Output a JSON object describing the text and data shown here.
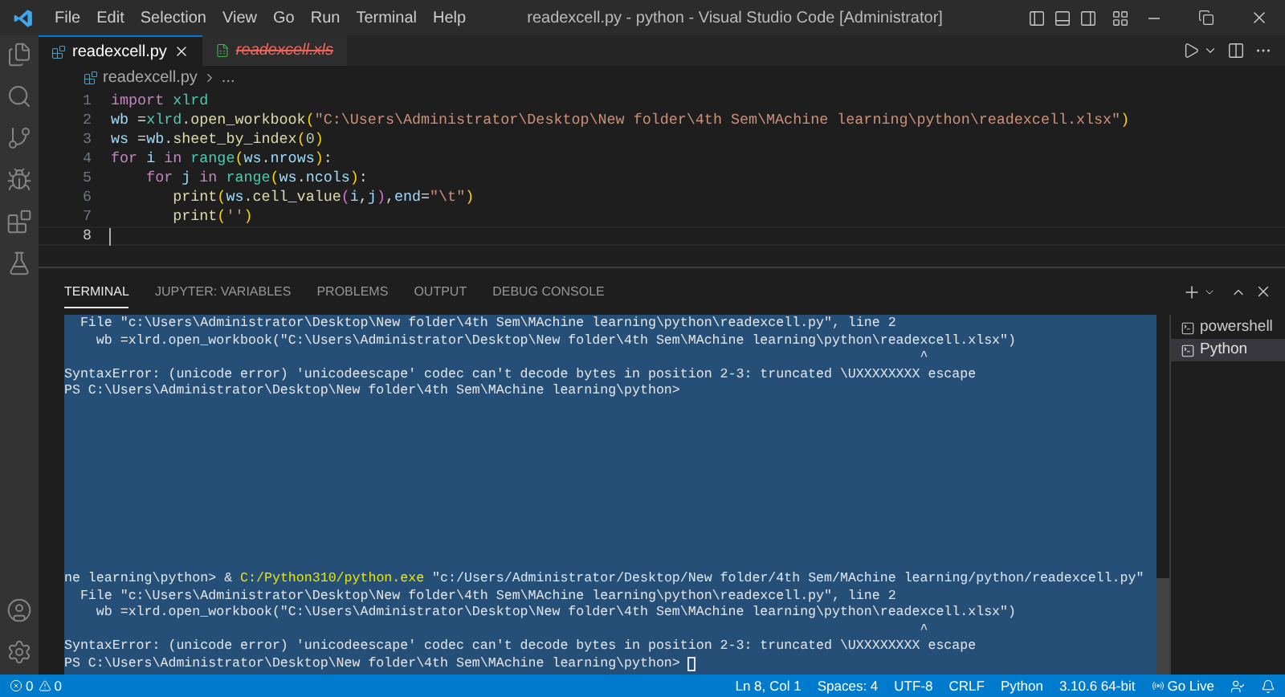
{
  "title_bar": {
    "menu": [
      "File",
      "Edit",
      "Selection",
      "View",
      "Go",
      "Run",
      "Terminal",
      "Help"
    ],
    "title": "readexcell.py - python - Visual Studio Code [Administrator]"
  },
  "editor": {
    "tabs": [
      {
        "label": "readexcell.py",
        "selected": true,
        "deleted": false,
        "kind": "python"
      },
      {
        "label": "readexcell.xls",
        "selected": false,
        "deleted": true,
        "kind": "excel"
      }
    ],
    "breadcrumb": {
      "file": "readexcell.py",
      "more": "..."
    },
    "lines": [
      {
        "number": "1",
        "current": false,
        "tokens": [
          {
            "text": "import ",
            "kind": "keyword"
          },
          {
            "text": "xlrd",
            "kind": "module"
          }
        ]
      },
      {
        "number": "2",
        "current": false,
        "tokens": [
          {
            "text": "wb",
            "kind": "variable"
          },
          {
            "text": " =",
            "kind": "plain"
          },
          {
            "text": "xlrd",
            "kind": "module"
          },
          {
            "text": ".",
            "kind": "plain"
          },
          {
            "text": "open_workbook",
            "kind": "function"
          },
          {
            "text": "(",
            "kind": "bracket1"
          },
          {
            "text": "\"C:\\Users\\Administrator\\Desktop\\New folder\\4th Sem\\MAchine learning\\python\\readexcell.xlsx\"",
            "kind": "string"
          },
          {
            "text": ")",
            "kind": "bracket1"
          }
        ]
      },
      {
        "number": "3",
        "current": false,
        "tokens": [
          {
            "text": "ws",
            "kind": "variable"
          },
          {
            "text": " =",
            "kind": "plain"
          },
          {
            "text": "wb",
            "kind": "variable"
          },
          {
            "text": ".",
            "kind": "plain"
          },
          {
            "text": "sheet_by_index",
            "kind": "function"
          },
          {
            "text": "(",
            "kind": "bracket1"
          },
          {
            "text": "0",
            "kind": "number"
          },
          {
            "text": ")",
            "kind": "bracket1"
          }
        ]
      },
      {
        "number": "4",
        "current": false,
        "tokens": [
          {
            "text": "for ",
            "kind": "keyword"
          },
          {
            "text": "i ",
            "kind": "variable"
          },
          {
            "text": "in ",
            "kind": "keyword"
          },
          {
            "text": "range",
            "kind": "module"
          },
          {
            "text": "(",
            "kind": "bracket1"
          },
          {
            "text": "ws",
            "kind": "variable"
          },
          {
            "text": ".",
            "kind": "plain"
          },
          {
            "text": "nrows",
            "kind": "variable"
          },
          {
            "text": ")",
            "kind": "bracket1"
          },
          {
            "text": ":",
            "kind": "plain"
          }
        ]
      },
      {
        "number": "5",
        "current": false,
        "tokens": [
          {
            "text": "    for ",
            "kind": "keyword"
          },
          {
            "text": "j ",
            "kind": "variable"
          },
          {
            "text": "in ",
            "kind": "keyword"
          },
          {
            "text": "range",
            "kind": "module"
          },
          {
            "text": "(",
            "kind": "bracket1"
          },
          {
            "text": "ws",
            "kind": "variable"
          },
          {
            "text": ".",
            "kind": "plain"
          },
          {
            "text": "ncols",
            "kind": "variable"
          },
          {
            "text": ")",
            "kind": "bracket1"
          },
          {
            "text": ":",
            "kind": "plain"
          }
        ]
      },
      {
        "number": "6",
        "current": false,
        "tokens": [
          {
            "text": "       print",
            "kind": "function"
          },
          {
            "text": "(",
            "kind": "bracket1"
          },
          {
            "text": "ws",
            "kind": "variable"
          },
          {
            "text": ".",
            "kind": "plain"
          },
          {
            "text": "cell_value",
            "kind": "function"
          },
          {
            "text": "(",
            "kind": "bracket2"
          },
          {
            "text": "i",
            "kind": "variable"
          },
          {
            "text": ",",
            "kind": "plain"
          },
          {
            "text": "j",
            "kind": "variable"
          },
          {
            "text": ")",
            "kind": "bracket2"
          },
          {
            "text": ",",
            "kind": "plain"
          },
          {
            "text": "end",
            "kind": "variable"
          },
          {
            "text": "=",
            "kind": "plain"
          },
          {
            "text": "\"\\t\"",
            "kind": "string"
          },
          {
            "text": ")",
            "kind": "bracket1"
          }
        ]
      },
      {
        "number": "7",
        "current": false,
        "tokens": [
          {
            "text": "       print",
            "kind": "function"
          },
          {
            "text": "(",
            "kind": "bracket1"
          },
          {
            "text": "''",
            "kind": "string"
          },
          {
            "text": ")",
            "kind": "bracket1"
          }
        ]
      },
      {
        "number": "8",
        "current": true
      }
    ]
  },
  "panel": {
    "tabs": [
      {
        "label": "TERMINAL",
        "selected": true
      },
      {
        "label": "JUPYTER: VARIABLES",
        "selected": false
      },
      {
        "label": "PROBLEMS",
        "selected": false
      },
      {
        "label": "OUTPUT",
        "selected": false
      },
      {
        "label": "DEBUG CONSOLE",
        "selected": false
      }
    ],
    "terminal": {
      "selected": true,
      "blocks": [
        [
          [
            {
              "text": "  File \"c:\\Users\\Administrator\\Desktop\\New folder\\4th Sem\\MAchine learning\\python\\readexcell.py\", line 2",
              "kind": "plain"
            }
          ],
          [
            {
              "text": "    wb =xlrd.open_workbook(\"C:\\Users\\Administrator\\Desktop\\New folder\\4th Sem\\MAchine learning\\python\\readexcell.xlsx\")",
              "kind": "plain"
            }
          ],
          [
            {
              "text": "                                                                                                           ^",
              "kind": "plain"
            }
          ],
          [
            {
              "text": "SyntaxError: (unicode error) 'unicodeescape' codec can't decode bytes in position 2-3: truncated \\UXXXXXXXX escape",
              "kind": "plain"
            }
          ],
          [
            {
              "text": "PS C:\\Users\\Administrator\\Desktop\\New folder\\4th Sem\\MAchine learning\\python>",
              "kind": "plain"
            }
          ]
        ],
        [
          [
            {
              "text": "ne learning\\python> & ",
              "kind": "plain"
            },
            {
              "text": "C:/Python310/python.exe",
              "kind": "command"
            },
            {
              "text": " \"c:/Users/Administrator/Desktop/New folder/4th Sem/MAchine learning/python/readexcell.py\"",
              "kind": "argument"
            }
          ],
          [
            {
              "text": "  File \"c:\\Users\\Administrator\\Desktop\\New folder\\4th Sem\\MAchine learning\\python\\readexcell.py\", line 2",
              "kind": "plain"
            }
          ],
          [
            {
              "text": "    wb =xlrd.open_workbook(\"C:\\Users\\Administrator\\Desktop\\New folder\\4th Sem\\MAchine learning\\python\\readexcell.xlsx\")",
              "kind": "plain"
            }
          ],
          [
            {
              "text": "                                                                                                           ^",
              "kind": "plain"
            }
          ],
          [
            {
              "text": "SyntaxError: (unicode error) 'unicodeescape' codec can't decode bytes in position 2-3: truncated \\UXXXXXXXX escape",
              "kind": "plain"
            }
          ],
          [
            {
              "text": "PS C:\\Users\\Administrator\\Desktop\\New folder\\4th Sem\\MAchine learning\\python> ",
              "kind": "plain"
            },
            {
              "kind": "cursor"
            }
          ]
        ]
      ]
    },
    "terminals": [
      {
        "label": "powershell",
        "selected": false
      },
      {
        "label": "Python",
        "selected": true
      }
    ]
  },
  "status_bar": {
    "errors": "0",
    "warnings": "0",
    "items": [
      "Ln 8, Col 1",
      "Spaces: 4",
      "UTF-8",
      "CRLF",
      "Python",
      "3.10.6 64-bit"
    ],
    "go_live": "Go Live"
  }
}
